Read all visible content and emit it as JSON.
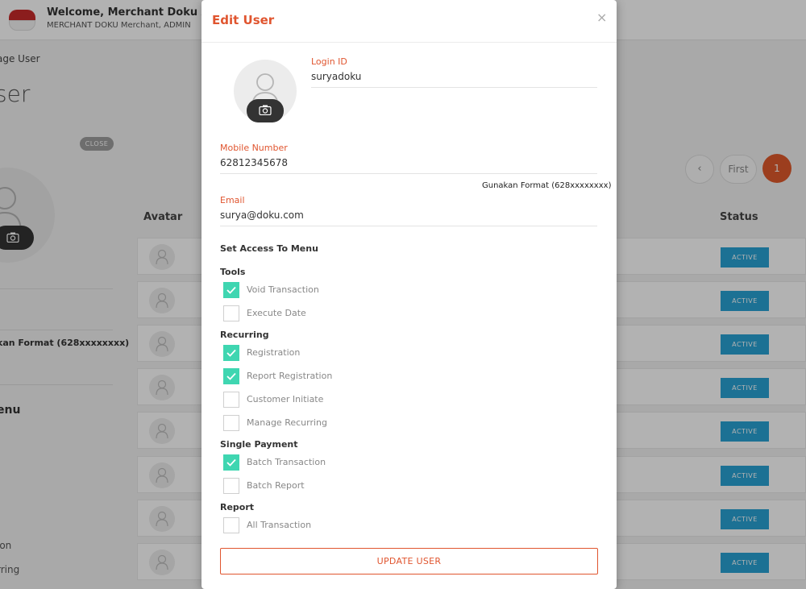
{
  "header": {
    "welcome": "Welcome, Merchant Doku Admin Te",
    "subtitle": "MERCHANT DOKU Merchant, ADMIN"
  },
  "background": {
    "breadcrumb": "age User",
    "page_title": "ser",
    "close_label": "CLOSE",
    "format_hint": "kan Format (628xxxxxxxx)",
    "menu_heading": "enu",
    "side_item_a": "ion",
    "side_item_b": "rring",
    "table": {
      "col_avatar": "Avatar",
      "col_status": "Status",
      "rows": [
        {
          "status": "ACTIVE"
        },
        {
          "status": "ACTIVE"
        },
        {
          "status": "ACTIVE"
        },
        {
          "status": "ACTIVE"
        },
        {
          "status": "ACTIVE"
        },
        {
          "status": "ACTIVE"
        },
        {
          "status": "ACTIVE"
        },
        {
          "status": "ACTIVE"
        }
      ]
    },
    "pagination": {
      "prev": "‹",
      "first": "First",
      "current": "1"
    }
  },
  "modal": {
    "title": "Edit User",
    "close": "×",
    "login_id": {
      "label": "Login ID",
      "value": "suryadoku"
    },
    "mobile": {
      "label": "Mobile Number",
      "value": "62812345678",
      "hint": "Gunakan Format (628xxxxxxxx)"
    },
    "email": {
      "label": "Email",
      "value": "surya@doku.com"
    },
    "access_title": "Set Access To Menu",
    "groups": [
      {
        "name": "Tools",
        "items": [
          {
            "label": "Void Transaction",
            "checked": true
          },
          {
            "label": "Execute Date",
            "checked": false
          }
        ]
      },
      {
        "name": "Recurring",
        "items": [
          {
            "label": "Registration",
            "checked": true
          },
          {
            "label": "Report Registration",
            "checked": true
          },
          {
            "label": "Customer Initiate",
            "checked": false
          },
          {
            "label": "Manage Recurring",
            "checked": false
          }
        ]
      },
      {
        "name": "Single Payment",
        "items": [
          {
            "label": "Batch Transaction",
            "checked": true
          },
          {
            "label": "Batch Report",
            "checked": false
          }
        ]
      },
      {
        "name": "Report",
        "items": [
          {
            "label": "All Transaction",
            "checked": false
          }
        ]
      }
    ],
    "update_button": "UPDATE USER"
  },
  "colors": {
    "accent": "#e0552f",
    "check": "#3fd6b1",
    "status_badge": "#29a3d4"
  }
}
